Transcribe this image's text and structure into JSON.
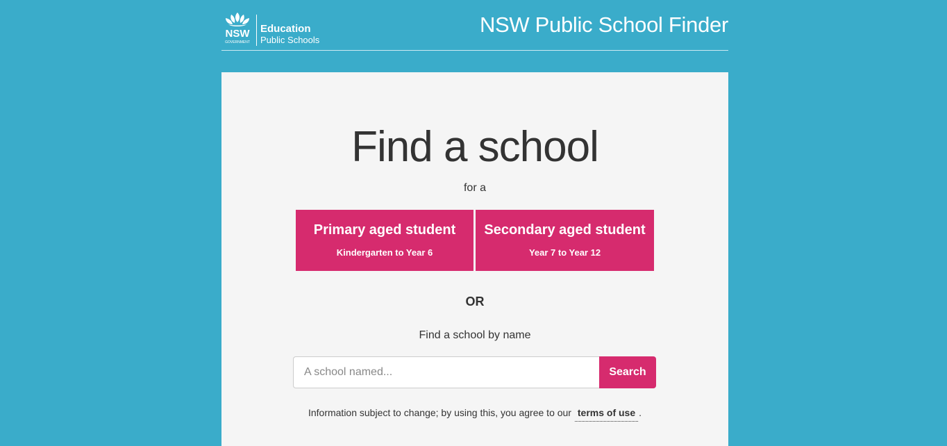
{
  "header": {
    "logo": {
      "wordmark": "NSW",
      "subtext": "GOVERNMENT",
      "line1": "Education",
      "line2": "Public Schools"
    },
    "title": "NSW Public School Finder"
  },
  "main": {
    "heading": "Find a school",
    "for_a": "for a",
    "options": [
      {
        "title": "Primary aged student",
        "subtitle": "Kindergarten to Year 6"
      },
      {
        "title": "Secondary aged student",
        "subtitle": "Year 7 to Year 12"
      }
    ],
    "or": "OR",
    "by_name": "Find a school by name",
    "search": {
      "placeholder": "A school named...",
      "value": "",
      "button": "Search"
    },
    "info": {
      "prefix": "Information subject to change; by using this, you agree to our",
      "link": "terms of use",
      "suffix": "."
    }
  },
  "colors": {
    "background": "#3aacca",
    "panel": "#f5f5f5",
    "accent": "#d62b6e"
  }
}
